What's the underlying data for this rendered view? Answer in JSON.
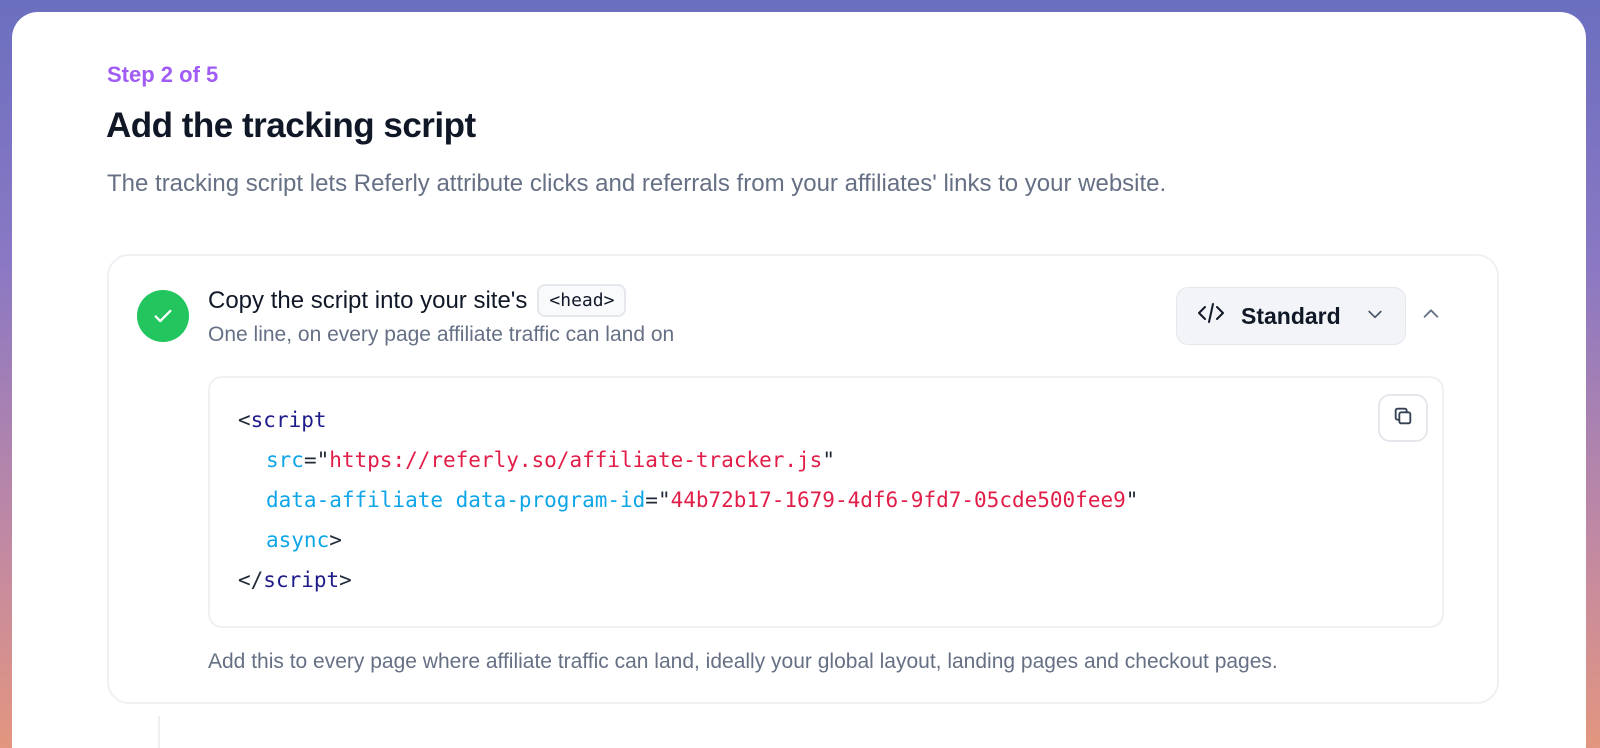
{
  "header": {
    "step": "Step 2 of 5",
    "title": "Add the tracking script",
    "subtitle": "The tracking script lets Referly attribute clicks and referrals from your affiliates' links to your website."
  },
  "panel": {
    "title_prefix": "Copy the script into your site's",
    "title_chip": "<head>",
    "subtitle": "One line, on every page affiliate traffic can land on",
    "dropdown_value": "Standard",
    "note": "Add this to every page where affiliate traffic can land, ideally your global layout, landing pages and checkout pages.",
    "code": {
      "l1_lt": "<",
      "l1_tag": "script",
      "l2_attr": "src",
      "l2_eq": "=\"",
      "l2_str": "https://referly.so/affiliate-tracker.js",
      "l2_end": "\"",
      "l3_attr": "data-affiliate data-program-id",
      "l3_eq": "=\"",
      "l3_str": "44b72b17-1679-4df6-9fd7-05cde500fee9",
      "l3_end": "\"",
      "l4_attr": "async",
      "l4_gt": ">",
      "l5_lt": "</",
      "l5_tag": "script",
      "l5_gt": ">"
    }
  },
  "icons": {
    "check": "check-icon",
    "code": "code-icon",
    "chevron_down": "chevron-down-icon",
    "chevron_up": "chevron-up-icon",
    "copy": "copy-icon"
  },
  "colors": {
    "accent": "#a05cf5",
    "success": "#22c55e",
    "code_tag": "#1e1b8a",
    "code_attr": "#0ea5e9",
    "code_string": "#e11d48"
  }
}
